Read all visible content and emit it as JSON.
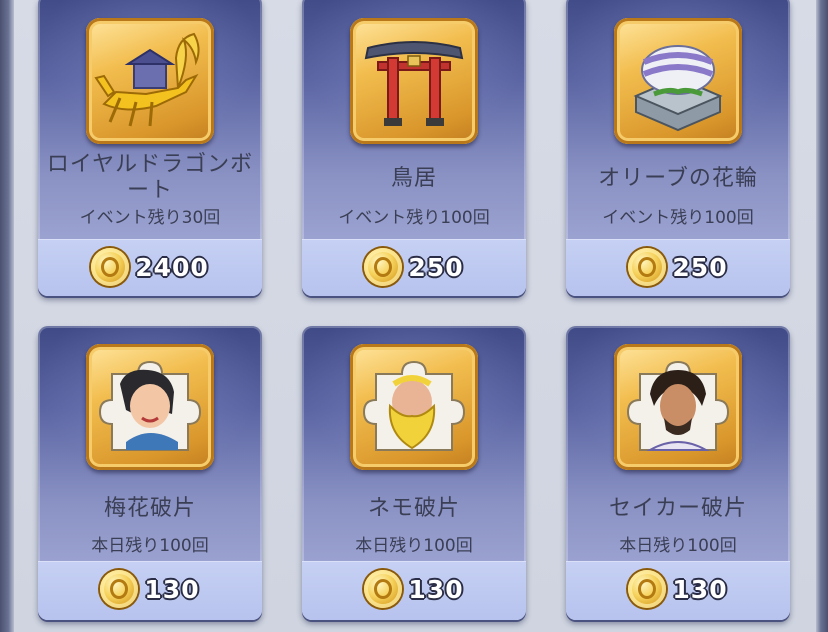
{
  "shop_items": [
    {
      "name": "ロイヤルドラゴンボート",
      "remaining": "イベント残り30回",
      "price": "2400",
      "icon": "dragon-boat-icon"
    },
    {
      "name": "鳥居",
      "remaining": "イベント残り100回",
      "price": "250",
      "icon": "torii-gate-icon"
    },
    {
      "name": "オリーブの花輪",
      "remaining": "イベント残り100回",
      "price": "250",
      "icon": "olive-wreath-icon"
    },
    {
      "name": "梅花破片",
      "remaining": "本日残り100回",
      "price": "130",
      "icon": "meihua-fragment-icon"
    },
    {
      "name": "ネモ破片",
      "remaining": "本日残り100回",
      "price": "130",
      "icon": "nemo-fragment-icon"
    },
    {
      "name": "セイカー破片",
      "remaining": "本日残り100回",
      "price": "130",
      "icon": "seika-fragment-icon"
    }
  ],
  "currency_icon": "gold-coin-icon",
  "colors": {
    "card_top": "#3f4a86",
    "card_bottom": "#aab1dc",
    "price_bar": "#c6d0f4",
    "gold_frame": "#f2bd4e",
    "text": "#3b3f55"
  }
}
